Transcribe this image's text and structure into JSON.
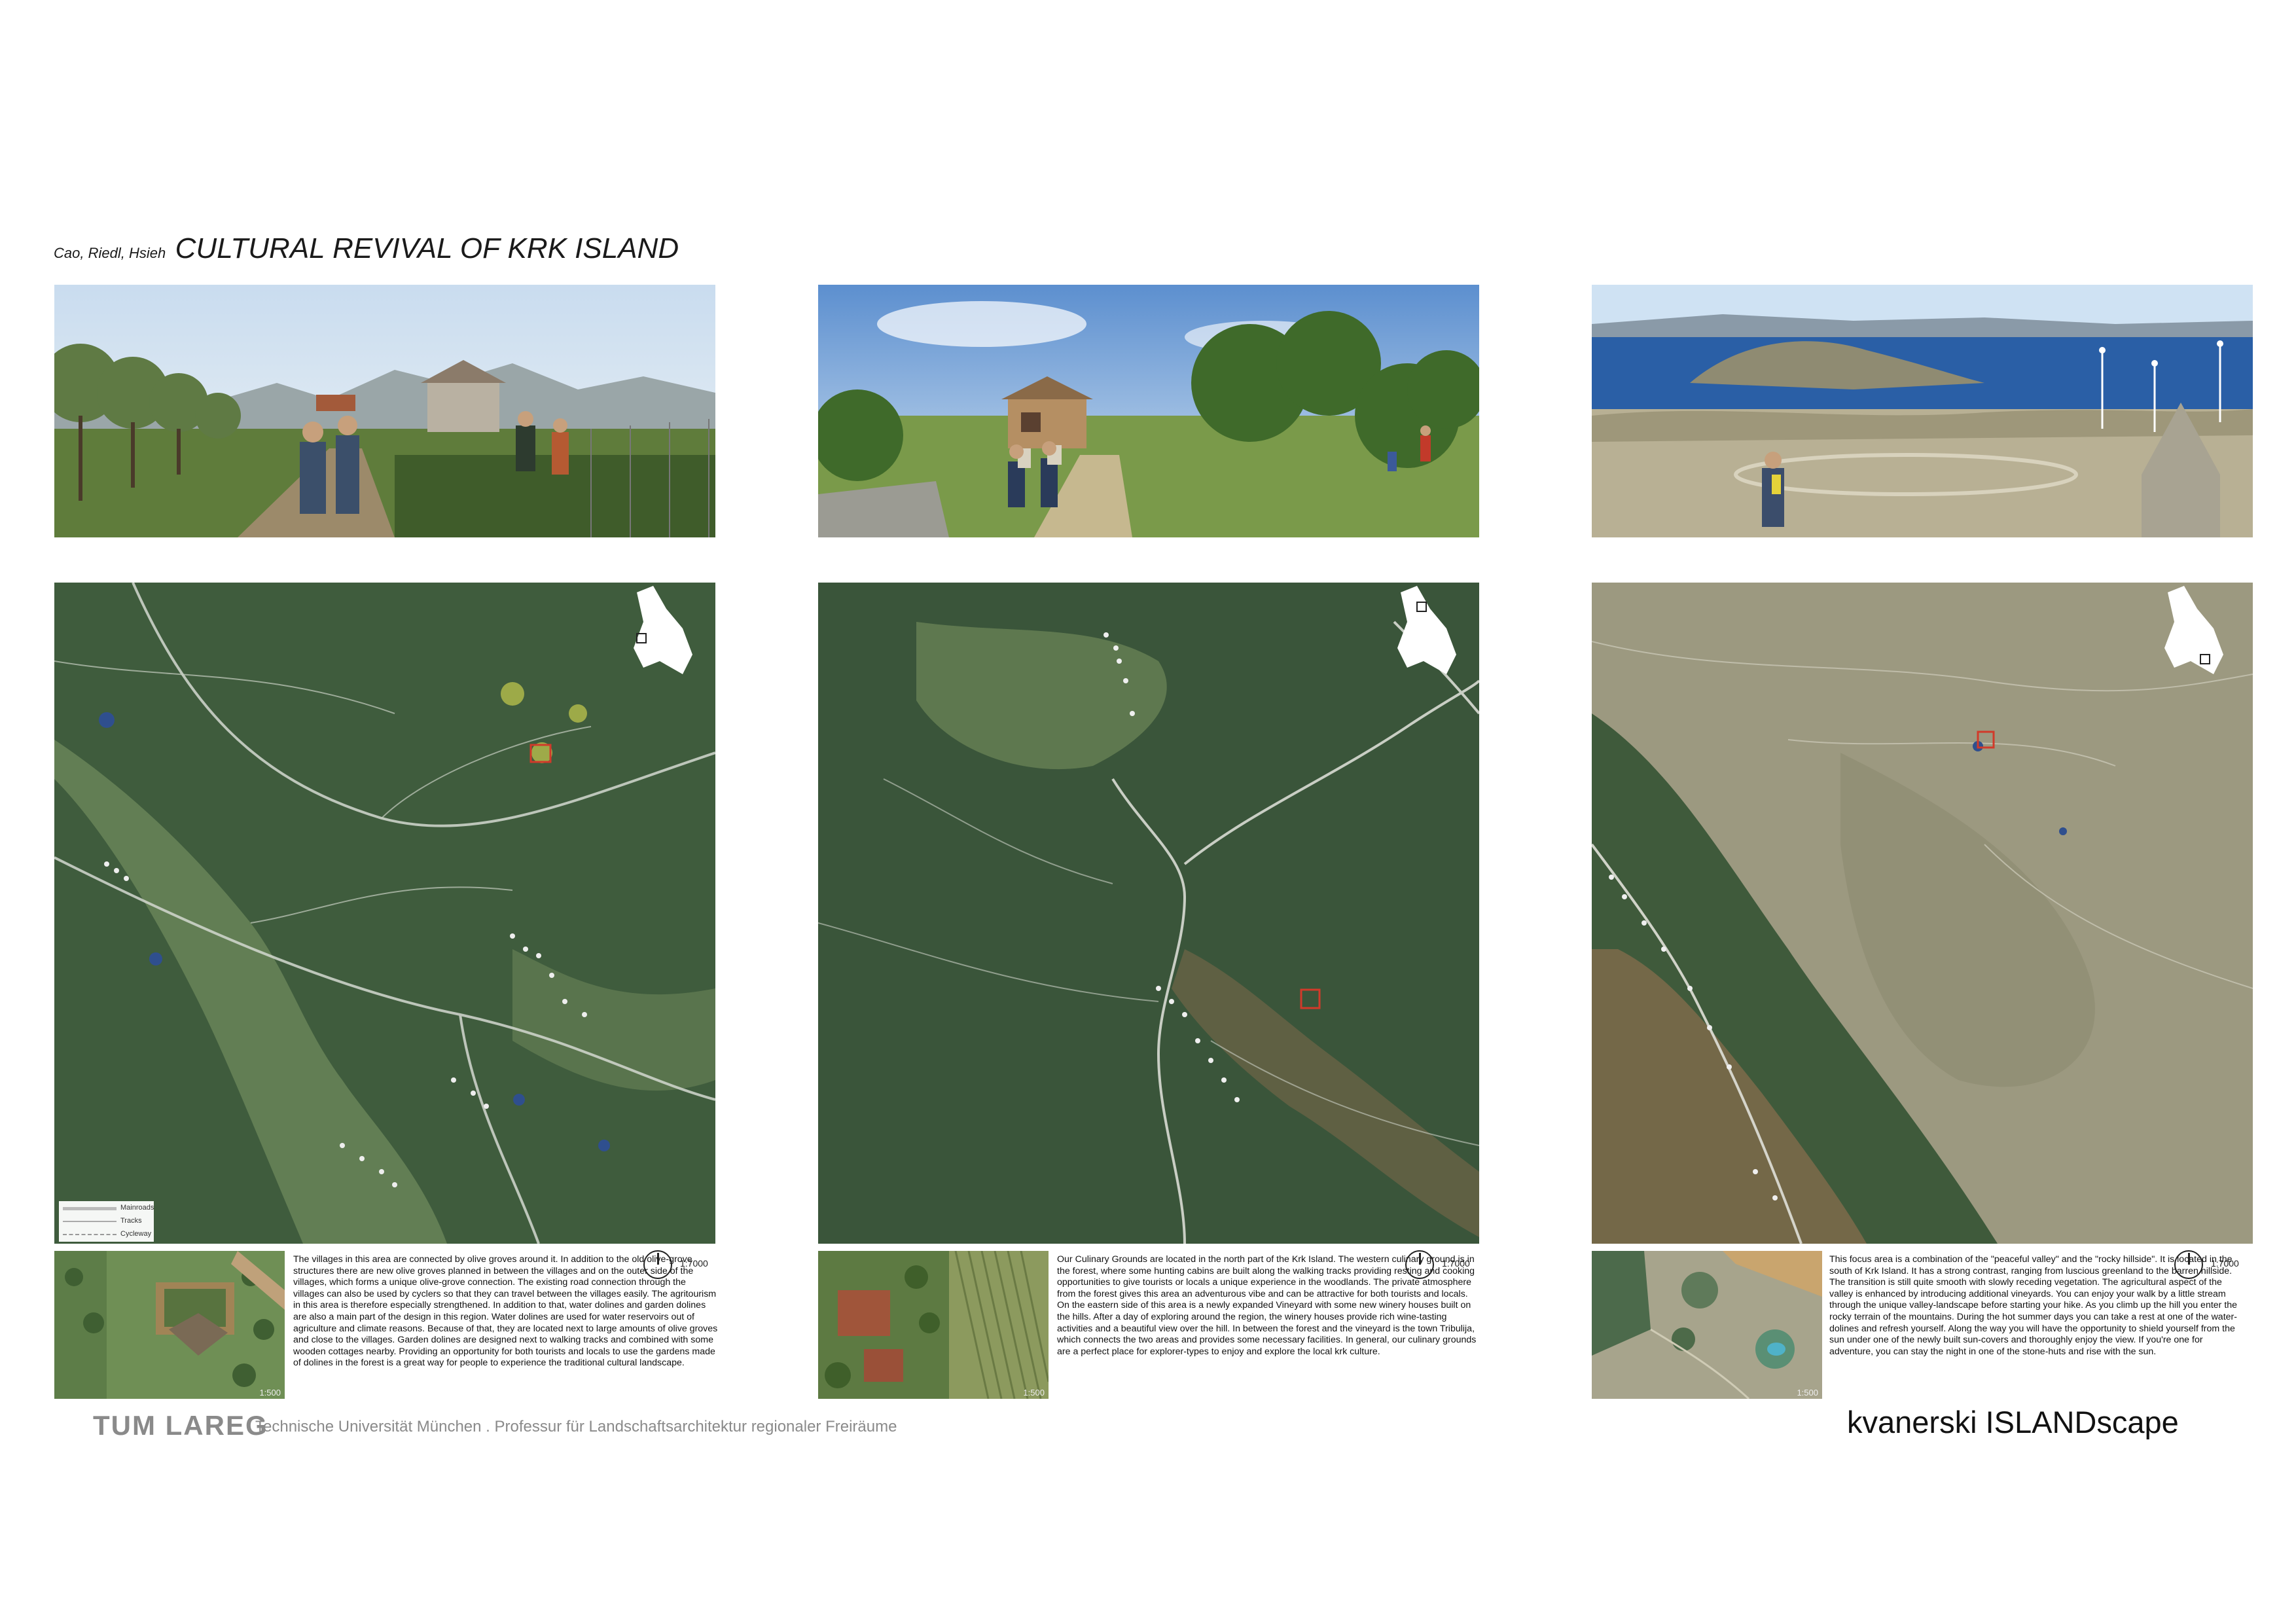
{
  "header": {
    "authors": "Cao, Riedl, Hsieh",
    "title": "CULTURAL REVIVAL OF KRK ISLAND"
  },
  "panels": [
    {
      "photo_alt": "panel-1-photo",
      "scale": "1:7000",
      "thumb_scale": "1:500",
      "description": "The villages in this area are connected by olive groves around it. In addition to the old olive-grove structures there are new olive groves planned in between the villages and on the outer side of the villages, which forms a unique olive-grove connection. The existing road connection through the villages can also be used by cyclers so that they can travel between the villages easily. The agritourism in this area is therefore especially strengthened. In addition to that, water dolines and garden dolines are also a main part of the design in this region. Water dolines are used for water reservoirs out of agriculture and climate reasons. Because of that, they are located next to large amounts of olive groves and close to the villages. Garden dolines are designed next to walking tracks and combined with some wooden cottages nearby. Providing an opportunity for both tourists and locals to use the gardens made of dolines in the forest is a great way for people to experience the traditional cultural landscape."
    },
    {
      "photo_alt": "panel-2-photo",
      "scale": "1:7000",
      "thumb_scale": "1:500",
      "description": "Our Culinary Grounds are located in the north part of the Krk Island. The western culinary ground is in the forest, where some hunting cabins are built along the walking tracks providing resting and cooking opportunities to give tourists or locals a unique experience in the woodlands. The private atmosphere from the forest gives this area an adventurous vibe and can be attractive for both tourists and locals. On the eastern side of this area is a newly expanded Vineyard with some new winery houses built on the hills. After a day of exploring around the region, the winery houses provide rich wine-tasting activities and a beautiful view over the hill. In between the forest and the vineyard is the town Tribulija, which connects the two areas and provides some necessary facilities. In general, our culinary grounds are a perfect place for explorer-types to enjoy and explore the local krk culture."
    },
    {
      "photo_alt": "panel-3-photo",
      "scale": "1:7000",
      "thumb_scale": "1:500",
      "description": "This focus area is a combination of the \"peaceful valley\" and the \"rocky hillside\". It is located in the south of Krk Island. It has a strong contrast, ranging from luscious greenland to the barren hillside. The transition is still quite smooth with slowly receding vegetation. The agricultural aspect of the valley is enhanced by introducing additional vineyards. You can enjoy your walk by a little stream through the unique valley-landscape before starting your hike. As you climb up the hill you enter the rocky terrain of the mountains. During the hot summer days you can take a rest at one of the water-dolines and refresh yourself. Along the way you will have the opportunity to shield yourself from the sun under one of the newly built sun-covers and thoroughly enjoy the view. If you're one for adventure, you can stay the night in one of the stone-huts and rise with the sun."
    }
  ],
  "legend": {
    "items": [
      "Mainroads",
      "Tracks",
      "Cycleway"
    ]
  },
  "footer": {
    "logo": "TUM LAREG",
    "institution": "Technische Universität München . Professur für Landschaftsarchitektur regionaler Freiräume",
    "brand": "kvanerski ISLANDscape"
  },
  "colors": {
    "forest": "#3e5a3f",
    "dark_forest": "#2f4a33",
    "olive_light": "#7d9460",
    "limestone": "#a9a48e",
    "sea": "#1f4f93",
    "sky": "#8fbde6",
    "footer_gray": "#8a8a8a"
  }
}
